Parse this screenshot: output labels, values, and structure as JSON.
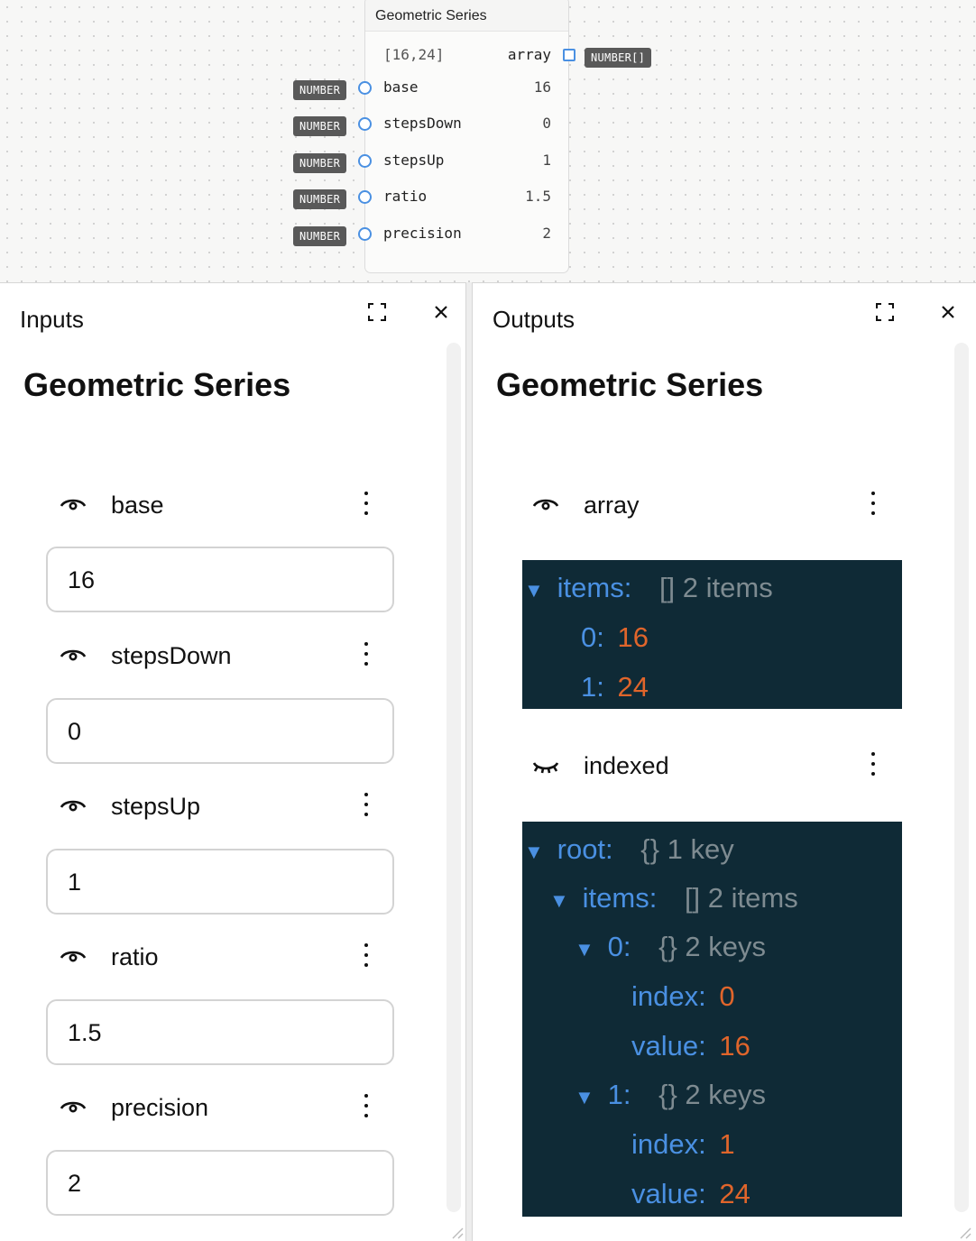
{
  "node": {
    "title": "Geometric Series",
    "output": {
      "preview": "[16,24]",
      "label": "array",
      "type": "NUMBER[]"
    },
    "inputs": [
      {
        "type": "NUMBER",
        "label": "base",
        "value": "16"
      },
      {
        "type": "NUMBER",
        "label": "stepsDown",
        "value": "0"
      },
      {
        "type": "NUMBER",
        "label": "stepsUp",
        "value": "1"
      },
      {
        "type": "NUMBER",
        "label": "ratio",
        "value": "1.5"
      },
      {
        "type": "NUMBER",
        "label": "precision",
        "value": "2"
      }
    ]
  },
  "inputs_panel": {
    "label": "Inputs",
    "heading": "Geometric Series",
    "fields": [
      {
        "name": "base",
        "value": "16"
      },
      {
        "name": "stepsDown",
        "value": "0"
      },
      {
        "name": "stepsUp",
        "value": "1"
      },
      {
        "name": "ratio",
        "value": "1.5"
      },
      {
        "name": "precision",
        "value": "2"
      }
    ]
  },
  "outputs_panel": {
    "label": "Outputs",
    "heading": "Geometric Series",
    "array": {
      "name": "array",
      "visible": true,
      "items_key": "items:",
      "items_meta": "[] 2 items",
      "entries": [
        {
          "key": "0:",
          "value": "16"
        },
        {
          "key": "1:",
          "value": "24"
        }
      ]
    },
    "indexed": {
      "name": "indexed",
      "visible": false,
      "root_key": "root:",
      "root_meta": "{} 1 key",
      "items_key": "items:",
      "items_meta": "[] 2 items",
      "entries": [
        {
          "key": "0:",
          "meta": "{} 2 keys",
          "index_key": "index:",
          "index": "0",
          "value_key": "value:",
          "value": "16"
        },
        {
          "key": "1:",
          "meta": "{} 2 keys",
          "index_key": "index:",
          "index": "1",
          "value_key": "value:",
          "value": "24"
        }
      ]
    }
  },
  "colors": {
    "port": "#4a90e2",
    "json_bg": "#0f2a36",
    "json_key": "#4a90e2",
    "json_number": "#e0652b",
    "json_meta": "#7e8b91",
    "type_tag": "#595959"
  }
}
